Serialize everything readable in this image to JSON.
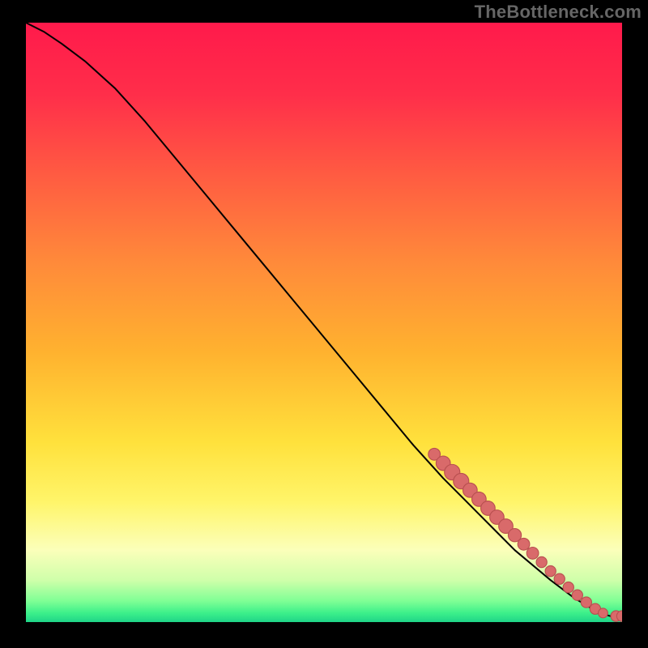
{
  "watermark": "TheBottleneck.com",
  "colors": {
    "background": "#000000",
    "gradient_stops": [
      {
        "offset": 0.0,
        "color": "#ff1a4b"
      },
      {
        "offset": 0.12,
        "color": "#ff2e4a"
      },
      {
        "offset": 0.25,
        "color": "#ff5a42"
      },
      {
        "offset": 0.4,
        "color": "#ff8a3a"
      },
      {
        "offset": 0.55,
        "color": "#ffb22f"
      },
      {
        "offset": 0.7,
        "color": "#ffe13c"
      },
      {
        "offset": 0.8,
        "color": "#fff56a"
      },
      {
        "offset": 0.88,
        "color": "#fbffba"
      },
      {
        "offset": 0.93,
        "color": "#cfffaa"
      },
      {
        "offset": 0.965,
        "color": "#7fff95"
      },
      {
        "offset": 0.985,
        "color": "#3cf08a"
      },
      {
        "offset": 1.0,
        "color": "#1fd488"
      }
    ],
    "curve": "#000000",
    "marker_fill": "#d96a6a",
    "marker_stroke": "#b84f4f"
  },
  "chart_data": {
    "type": "line",
    "title": "",
    "xlabel": "",
    "ylabel": "",
    "xlim": [
      0,
      100
    ],
    "ylim": [
      0,
      100
    ],
    "grid": false,
    "legend": false,
    "series": [
      {
        "name": "curve",
        "x": [
          0,
          3,
          6,
          10,
          15,
          20,
          25,
          30,
          35,
          40,
          45,
          50,
          55,
          60,
          65,
          70,
          73,
          76,
          79,
          82,
          85,
          88,
          90,
          92,
          94,
          95,
          96,
          98,
          100
        ],
        "y": [
          100,
          98.5,
          96.5,
          93.5,
          89,
          83.5,
          77.5,
          71.5,
          65.5,
          59.5,
          53.5,
          47.5,
          41.5,
          35.5,
          29.5,
          24,
          21,
          18,
          15,
          12,
          9.5,
          7,
          5.5,
          4,
          2.8,
          2.2,
          1.6,
          1.0,
          1.0
        ]
      }
    ],
    "markers": [
      {
        "x": 68.5,
        "y": 28.0,
        "r": 1.0
      },
      {
        "x": 70.0,
        "y": 26.5,
        "r": 1.2
      },
      {
        "x": 71.5,
        "y": 25.0,
        "r": 1.3
      },
      {
        "x": 73.0,
        "y": 23.5,
        "r": 1.3
      },
      {
        "x": 74.5,
        "y": 22.0,
        "r": 1.2
      },
      {
        "x": 76.0,
        "y": 20.5,
        "r": 1.2
      },
      {
        "x": 77.5,
        "y": 19.0,
        "r": 1.2
      },
      {
        "x": 79.0,
        "y": 17.5,
        "r": 1.2
      },
      {
        "x": 80.5,
        "y": 16.0,
        "r": 1.2
      },
      {
        "x": 82.0,
        "y": 14.5,
        "r": 1.1
      },
      {
        "x": 83.5,
        "y": 13.0,
        "r": 1.0
      },
      {
        "x": 85.0,
        "y": 11.5,
        "r": 1.0
      },
      {
        "x": 86.5,
        "y": 10.0,
        "r": 0.9
      },
      {
        "x": 88.0,
        "y": 8.5,
        "r": 0.9
      },
      {
        "x": 89.5,
        "y": 7.2,
        "r": 0.9
      },
      {
        "x": 91.0,
        "y": 5.8,
        "r": 0.9
      },
      {
        "x": 92.5,
        "y": 4.5,
        "r": 0.9
      },
      {
        "x": 94.0,
        "y": 3.3,
        "r": 0.9
      },
      {
        "x": 95.5,
        "y": 2.2,
        "r": 0.9
      },
      {
        "x": 96.8,
        "y": 1.5,
        "r": 0.8
      },
      {
        "x": 99.0,
        "y": 1.0,
        "r": 0.9
      },
      {
        "x": 100.0,
        "y": 1.0,
        "r": 0.9
      }
    ]
  }
}
